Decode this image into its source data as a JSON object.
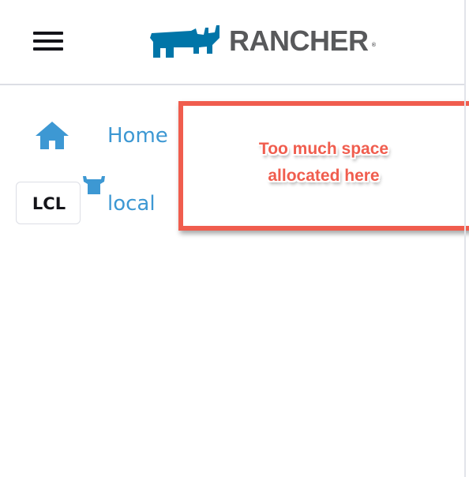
{
  "header": {
    "menu_icon": "hamburger-menu-icon",
    "logo": {
      "brand": "RANCHER",
      "registered_mark": "®",
      "icon": "rancher-bull-logo-icon",
      "color": "#0075a8"
    }
  },
  "nav": {
    "items": [
      {
        "label": "Home",
        "icon": "home-icon"
      },
      {
        "label": "local",
        "abbr": "LCL",
        "icon": "rancher-cow-icon"
      }
    ]
  },
  "annotation": {
    "line1": "Too much space",
    "line2": "allocated here",
    "color": "#f05d4e"
  },
  "colors": {
    "link": "#3d98d3",
    "brand_text": "#58595b",
    "divider": "#dcdee5"
  }
}
